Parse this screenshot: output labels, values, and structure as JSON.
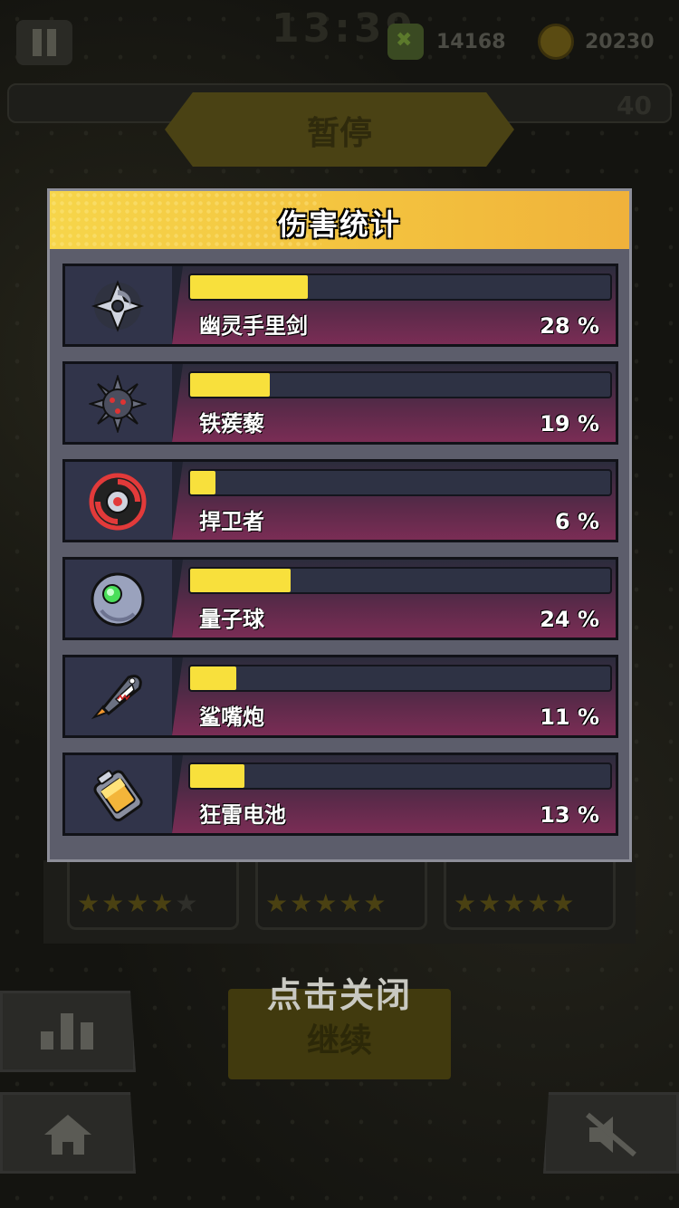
{
  "hud": {
    "clock": "13:39",
    "kills": "14168",
    "coins": "20230",
    "level": "40",
    "pause_title": "暂停"
  },
  "panel": {
    "title": "伤害统计",
    "rows": [
      {
        "name": "幽灵手里剑",
        "percent_text": "28 %",
        "fraction": 0.28,
        "icon": "shuriken-icon"
      },
      {
        "name": "铁蒺藜",
        "percent_text": "19 %",
        "fraction": 0.19,
        "icon": "spiked-mine-icon"
      },
      {
        "name": "捍卫者",
        "percent_text": "6 %",
        "fraction": 0.06,
        "icon": "defender-icon"
      },
      {
        "name": "量子球",
        "percent_text": "24 %",
        "fraction": 0.24,
        "icon": "quantum-orb-icon"
      },
      {
        "name": "鲨嘴炮",
        "percent_text": "11 %",
        "fraction": 0.11,
        "icon": "shark-rocket-icon"
      },
      {
        "name": "狂雷电池",
        "percent_text": "13 %",
        "fraction": 0.13,
        "icon": "battery-icon"
      }
    ]
  },
  "footer": {
    "tap_to_close": "点击关闭",
    "continue_label": "继续"
  },
  "stars": [
    {
      "filled": 4,
      "total": 5
    },
    {
      "filled": 5,
      "total": 5
    },
    {
      "filled": 5,
      "total": 5
    }
  ],
  "colors": {
    "header_yellow": "#f3c13e",
    "bar_fill": "#f8e03c",
    "panel_bg": "#5c5d6b",
    "row_magenta": "#7a2d55"
  }
}
